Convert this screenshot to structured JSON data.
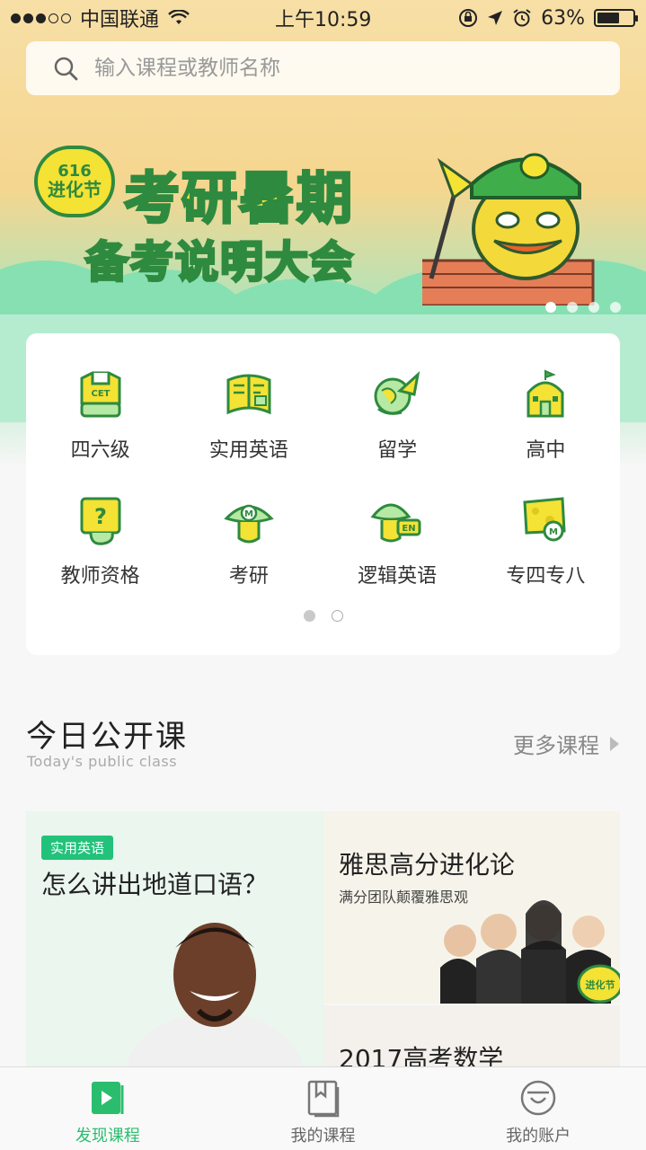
{
  "status_bar": {
    "carrier": "中国联通",
    "time": "上午10:59",
    "battery": "63%",
    "battery_level": 0.63
  },
  "search": {
    "placeholder": "输入课程或教师名称",
    "icon": "search-icon"
  },
  "banner": {
    "badge_number": "616",
    "badge_text": "进化节",
    "title": "考研暑期",
    "subtitle": "备考说明大会",
    "dot_count": 4,
    "active_dot": 0
  },
  "categories": {
    "items": [
      {
        "label": "四六级",
        "icon": "cet-shirt-icon",
        "badge": "CET"
      },
      {
        "label": "实用英语",
        "icon": "book-icon"
      },
      {
        "label": "留学",
        "icon": "globe-rocket-icon"
      },
      {
        "label": "高中",
        "icon": "school-house-icon"
      },
      {
        "label": "教师资格",
        "icon": "question-block-icon"
      },
      {
        "label": "考研",
        "icon": "mushroom-icon"
      },
      {
        "label": "逻辑英语",
        "icon": "en-mushroom-icon",
        "badge": "EN"
      },
      {
        "label": "专四专八",
        "icon": "cheese-badge-icon"
      }
    ],
    "page_count": 2,
    "active_page": 0
  },
  "section": {
    "title": "今日公开课",
    "subtitle": "Today's public class",
    "more_label": "更多课程"
  },
  "courses": [
    {
      "tag": "实用英语",
      "title": "怎么讲出地道口语？"
    },
    {
      "title": "雅思高分进化论",
      "subtitle": "满分团队颠覆雅思观",
      "badge": "进化节"
    },
    {
      "title": "2017高考数学"
    }
  ],
  "tabbar": {
    "items": [
      {
        "label": "发现课程",
        "icon": "play-square-icon",
        "active": true
      },
      {
        "label": "我的课程",
        "icon": "bookmark-book-icon",
        "active": false
      },
      {
        "label": "我的账户",
        "icon": "smile-face-icon",
        "active": false
      }
    ]
  },
  "colors": {
    "accent": "#2bbd6e",
    "tag_green": "#22c27a",
    "banner_yellow": "#f6e43a",
    "banner_green": "#2e8a3f"
  }
}
